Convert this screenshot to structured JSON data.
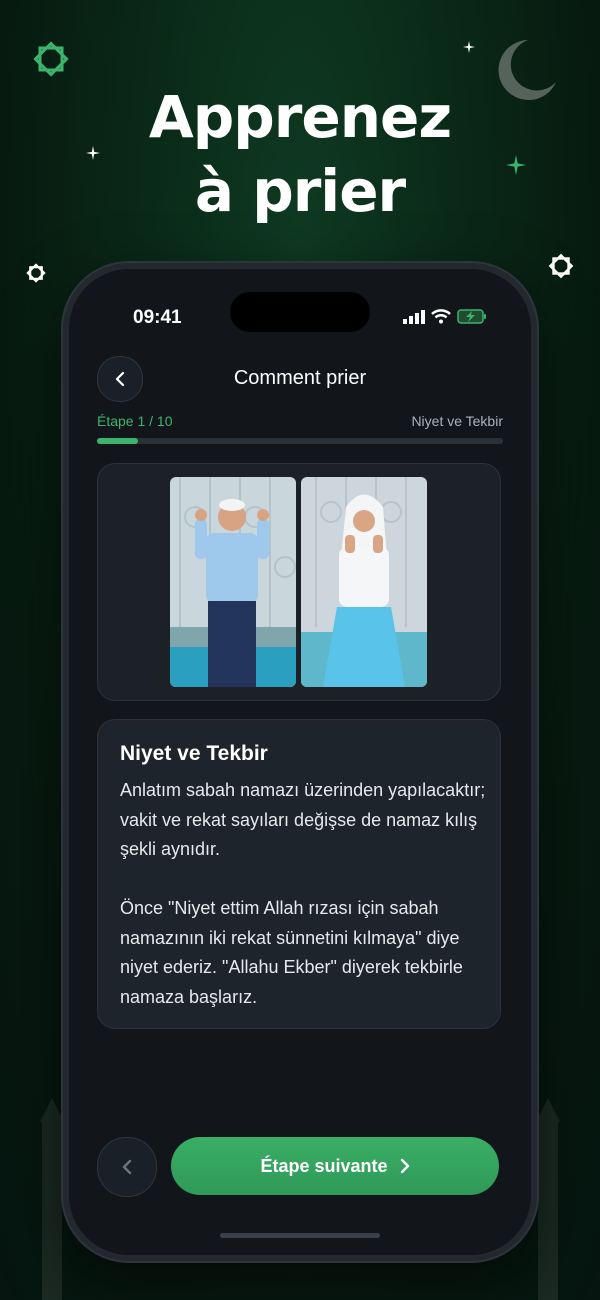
{
  "promo": {
    "headline_line1": "Apprenez",
    "headline_line2": "à prier"
  },
  "status_bar": {
    "time": "09:41"
  },
  "header": {
    "title": "Comment prier"
  },
  "progress": {
    "step_label": "Étape 1 / 10",
    "step_name": "Niyet ve Tekbir",
    "current": 1,
    "total": 10
  },
  "content": {
    "title": "Niyet ve Tekbir",
    "paragraph1": "Anlatım sabah namazı üzerinden yapılacaktır; vakit ve rekat sayıları değişse de namaz kılış şekli aynıdır.",
    "paragraph2": "Önce \"Niyet ettim Allah rızası için sabah namazının iki rekat sünnetini kılmaya\" diye niyet ederiz. \"Allahu Ekber\" diyerek tekbirle namaza başlarız."
  },
  "footer": {
    "next_label": "Étape suivante"
  },
  "colors": {
    "accent": "#3cb46e",
    "background": "#12161b",
    "card": "#1e242c"
  }
}
